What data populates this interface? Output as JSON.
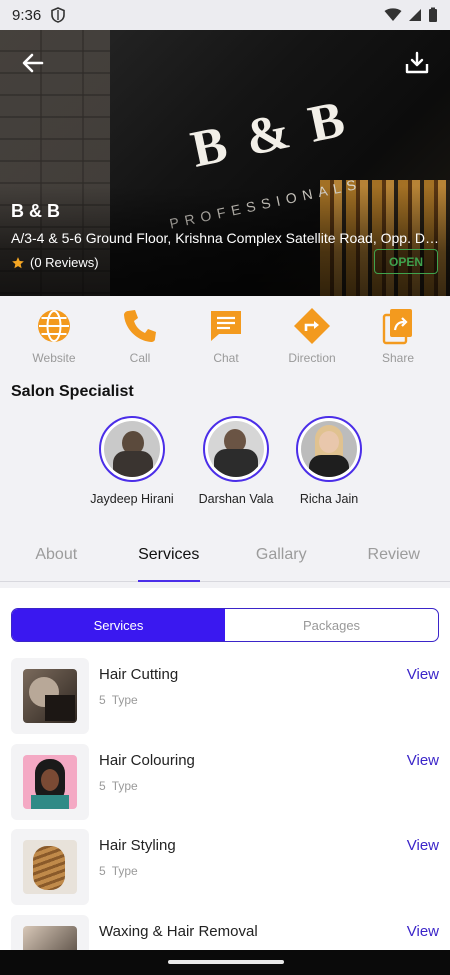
{
  "status_bar": {
    "time": "9:36"
  },
  "hero": {
    "sign_text": "B & B",
    "sign_sub": "PROFESSIONALS",
    "name": "B & B",
    "address": "A/3-4 & 5-6 Ground Floor, Krishna Complex Satellite Road, Opp. De...",
    "reviews": "(0 Reviews)",
    "open_badge": "OPEN"
  },
  "actions": [
    {
      "label": "Website",
      "icon": "globe-icon"
    },
    {
      "label": "Call",
      "icon": "phone-icon"
    },
    {
      "label": "Chat",
      "icon": "chat-icon"
    },
    {
      "label": "Direction",
      "icon": "direction-icon"
    },
    {
      "label": "Share",
      "icon": "share-icon"
    }
  ],
  "specialists": {
    "title": "Salon Specialist",
    "items": [
      {
        "name": "Jaydeep Hirani"
      },
      {
        "name": "Darshan Vala"
      },
      {
        "name": "Richa Jain"
      }
    ]
  },
  "tabs": [
    "About",
    "Services",
    "Gallary",
    "Review"
  ],
  "segment": {
    "services": "Services",
    "packages": "Packages"
  },
  "services": [
    {
      "title": "Hair Cutting",
      "count": "5",
      "type_label": "Type",
      "view": "View"
    },
    {
      "title": "Hair Colouring",
      "count": "5",
      "type_label": "Type",
      "view": "View"
    },
    {
      "title": "Hair Styling",
      "count": "5",
      "type_label": "Type",
      "view": "View"
    },
    {
      "title": "Waxing & Hair Removal",
      "count": "",
      "type_label": "",
      "view": "View"
    }
  ],
  "colors": {
    "accent": "#3a18f0",
    "action_orange": "#f39a1e",
    "open_green": "#3fa34d",
    "ring": "#4b2ee8"
  }
}
